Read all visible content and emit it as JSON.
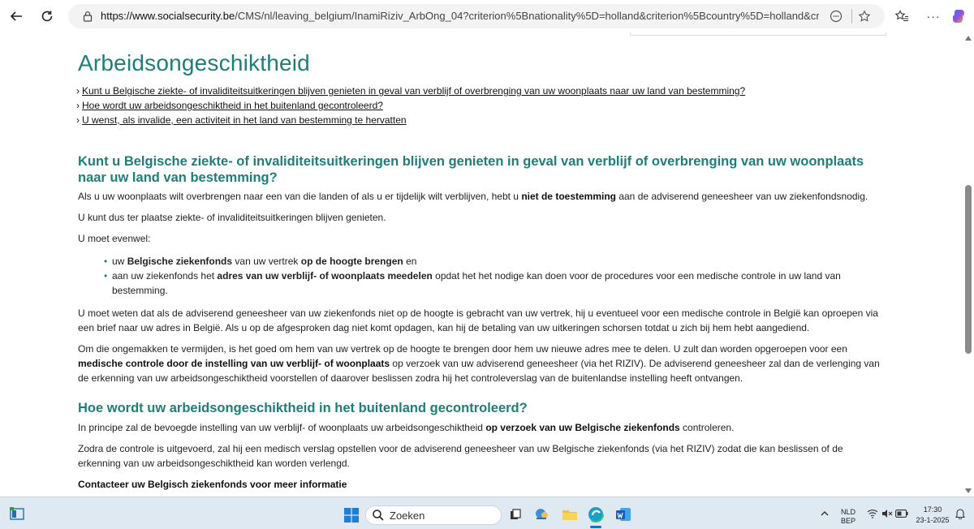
{
  "browser": {
    "url_domain": "https://www.socialsecurity.be",
    "url_rest": "/CMS/nl/leaving_belgium/InamiRiziv_ArbOng_04?criterion%5Bnationality%5D=holland&criterion%5Bcountry%5D=holland&criterion%5B..."
  },
  "page": {
    "title": "Arbeidsongeschiktheid",
    "toc": [
      "Kunt u Belgische ziekte- of invaliditeitsuitkeringen blijven genieten in geval van verblijf of overbrenging van uw woonplaats naar uw land van bestemming?",
      "Hoe wordt uw arbeidsongeschiktheid in het buitenland gecontroleerd?",
      "U wenst, als invalide, een activiteit in het land van bestemming te hervatten"
    ],
    "toc_arrow": "›",
    "section1": {
      "heading": "Kunt u Belgische ziekte- of invaliditeitsuitkeringen blijven genieten in geval van verblijf of overbrenging van uw woonplaats naar uw land van bestemming?",
      "p1_a": "Als u uw woonplaats wilt overbrengen naar een van die landen of als u er tijdelijk wilt verblijven, hebt u ",
      "p1_b": "niet de toestemming",
      "p1_c": " aan de adviserend geneesheer van uw ziekenfondsnodig.",
      "p2": "U kunt dus ter plaatse ziekte- of invaliditeitsuitkeringen blijven genieten.",
      "p3": "U moet evenwel:",
      "b1_a": "uw ",
      "b1_b": "Belgische ziekenfonds",
      "b1_c": " van uw vertrek ",
      "b1_d": "op de hoogte brengen",
      "b1_e": " en",
      "b2_a": "aan uw ziekenfonds het ",
      "b2_b": "adres van uw verblijf- of woonplaats meedelen",
      "b2_c": " opdat het het nodige kan doen voor de procedures voor een medische controle in uw land van bestemming.",
      "p4": "U moet weten dat als de adviserend geneesheer van uw ziekenfonds niet op de hoogte is gebracht van uw vertrek, hij u eventueel voor een medische controle in België kan oproepen via een brief naar uw adres in België. Als u op de afgesproken dag niet komt opdagen, kan hij de betaling van uw uitkeringen schorsen totdat u zich bij hem hebt aangediend.",
      "p5_a": "Om die ongemakken te vermijden, is het goed om hem van uw vertrek op de hoogte te brengen door hem uw nieuwe adres mee te delen. U zult dan worden opgeroepen voor een ",
      "p5_b": "medische controle door de instelling van uw verblijf- of woonplaats",
      "p5_c": " op verzoek van uw adviserend geneesheer (via het RIZIV). De adviserend geneesheer zal dan de verlenging van de erkenning van uw arbeidsongeschiktheid voorstellen of daarover beslissen zodra hij het controleverslag van de buitenlandse instelling heeft ontvangen."
    },
    "section2": {
      "heading": "Hoe wordt uw arbeidsongeschiktheid in het buitenland gecontroleerd?",
      "p1_a": "In principe zal de bevoegde instelling van uw verblijf- of woonplaats uw arbeidsongeschiktheid ",
      "p1_b": "op verzoek van uw Belgische ziekenfonds",
      "p1_c": " controleren.",
      "p2": "Zodra de controle is uitgevoerd, zal hij een medisch verslag opstellen voor de adviserend geneesheer van uw Belgische ziekenfonds (via het RIZIV) zodat die kan beslissen of de erkenning van uw arbeidsongeschiktheid kan worden verlengd.",
      "p3": "Contacteer uw Belgisch ziekenfonds voor meer informatie"
    }
  },
  "taskbar": {
    "search_label": "Zoeken",
    "lang_top": "NLD",
    "lang_bottom": "BEP",
    "time": "17:30",
    "date": "23-1-2025"
  },
  "colors": {
    "accent": "#1a8079",
    "taskbar_bg": "#dfe9f2"
  }
}
